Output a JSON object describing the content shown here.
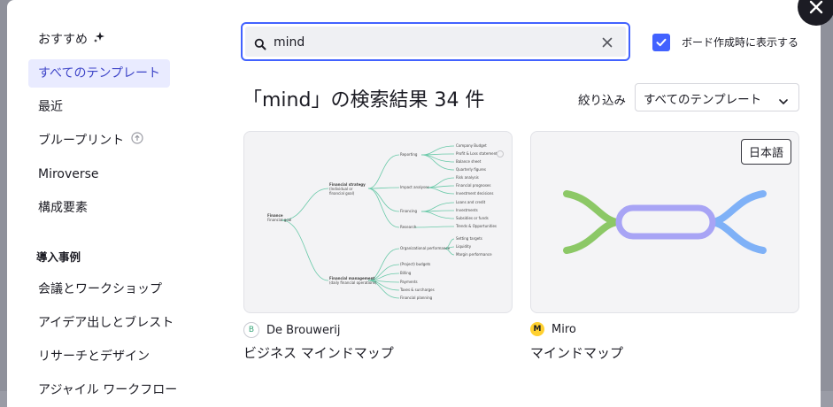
{
  "sidebar": {
    "items": [
      {
        "label": "おすすめ"
      },
      {
        "label": "すべてのテンプレート"
      },
      {
        "label": "最近"
      },
      {
        "label": "ブループリント"
      },
      {
        "label": "Miroverse"
      },
      {
        "label": "構成要素"
      }
    ],
    "section_heading": "導入事例",
    "use_cases": [
      {
        "label": "会議とワークショップ"
      },
      {
        "label": "アイデア出しとブレスト"
      },
      {
        "label": "リサーチとデザイン"
      },
      {
        "label": "アジャイル ワークフロー"
      }
    ]
  },
  "search": {
    "value": "mind"
  },
  "show_on_create": {
    "label": "ボード作成時に表示する",
    "checked": true
  },
  "results": {
    "title": "「mind」の検索結果 34 件",
    "filter_label": "絞り込み",
    "filter_value": "すべてのテンプレート"
  },
  "cards": [
    {
      "author": "De Brouwerij",
      "title": "ビジネス マインドマップ",
      "preview": {
        "root": [
          "Finance",
          "Financial goal"
        ],
        "branch1": [
          "Financial strategy",
          "(Individual or",
          "financial goal)"
        ],
        "branch2": [
          "Financial management",
          "(daily financial operations)"
        ],
        "leaves_a": [
          "Reporting",
          "Impact analyses",
          "Financing",
          "Research"
        ],
        "leaves_b": [
          "Company Budget",
          "Profit & Loss statement",
          "Balance sheet",
          "Quarterly figures",
          "Risk analysis",
          "Financial prognoses",
          "Investment decisions",
          "Loans and credit",
          "Investments",
          "Subsidies or funds",
          "Trends & Opportunities"
        ],
        "leaves_c": [
          "Organizational performance",
          "(Project) budgets",
          "Billing",
          "Payments",
          "Taxes & surcharges",
          "Financial planning"
        ],
        "leaves_d": [
          "Setting targets",
          "Liquidity",
          "Margin performance"
        ]
      }
    },
    {
      "author": "Miro",
      "title": "マインドマップ",
      "badge": "日本語"
    }
  ],
  "colors": {
    "accent": "#4262ff",
    "active_bg": "#e9ebff",
    "mind_green": "#8cc866",
    "mind_purple": "#a8a4f5",
    "mind_blue": "#7fb1f7"
  }
}
